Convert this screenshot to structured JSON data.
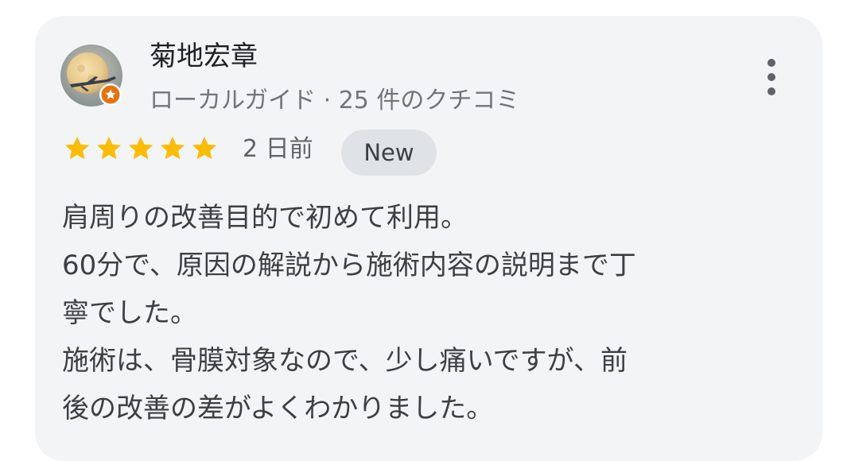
{
  "review": {
    "author_name": "菊地宏章",
    "author_meta": "ローカルガイド · 25 件のクチコミ",
    "avatar_icon": "moon-airplane-photo-avatar",
    "badge_icon": "local-guide-star-badge-icon",
    "rating": 5,
    "rating_max": 5,
    "date": "2 日前",
    "new_label": "New",
    "more_icon": "more-vert-icon",
    "text_lines": [
      "肩周りの改善目的で初めて利用。",
      "60分で、原因の解説から施術内容の説明まで丁",
      "寧でした。",
      "施術は、骨膜対象なので、少し痛いですが、前",
      "後の改善の差がよくわかりました。"
    ]
  },
  "colors": {
    "card_background": "#f3f4f6",
    "star": "#fbbc04",
    "badge_orange": "#e8710a",
    "name_text": "#202124",
    "meta_text": "#70757a",
    "body_text": "#3c4043"
  }
}
